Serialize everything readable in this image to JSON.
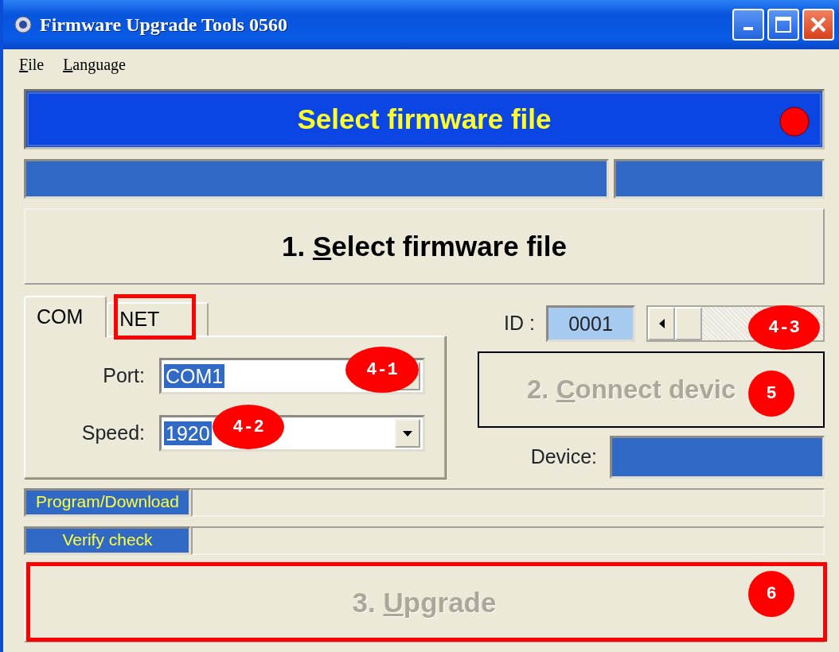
{
  "window": {
    "title": "Firmware Upgrade Tools 0560"
  },
  "menu": [
    {
      "key": "F",
      "after": "ile"
    },
    {
      "key": "L",
      "after": "anguage"
    }
  ],
  "status_banner": {
    "text": "Select firmware file"
  },
  "select_button": {
    "before": "1. ",
    "key": "S",
    "after": "elect firmware file",
    "disabled": false
  },
  "tabs": [
    {
      "label": "COM",
      "selected": true
    },
    {
      "label": "NET",
      "selected": false
    }
  ],
  "port": {
    "label": "Port:",
    "value": "COM1"
  },
  "speed": {
    "label": "Speed:",
    "value": "1920"
  },
  "id": {
    "label": "ID :",
    "value": "0001"
  },
  "connect_button": {
    "before": "2. ",
    "key": "C",
    "after": "onnect devic",
    "disabled": true
  },
  "device": {
    "label": "Device:"
  },
  "progress": [
    {
      "label": "Program/Download"
    },
    {
      "label": "Verify check"
    }
  ],
  "upgrade_button": {
    "before": "3. ",
    "key": "U",
    "after": "pgrade",
    "disabled": true
  },
  "annotations": [
    {
      "kind": "frame"
    },
    {
      "kind": "badge",
      "label": "4-1"
    },
    {
      "kind": "badge",
      "label": "4-2"
    },
    {
      "kind": "badge",
      "label": "4-3"
    },
    {
      "kind": "badge",
      "label": "5"
    },
    {
      "kind": "frame"
    },
    {
      "kind": "badge",
      "label": "6"
    }
  ]
}
